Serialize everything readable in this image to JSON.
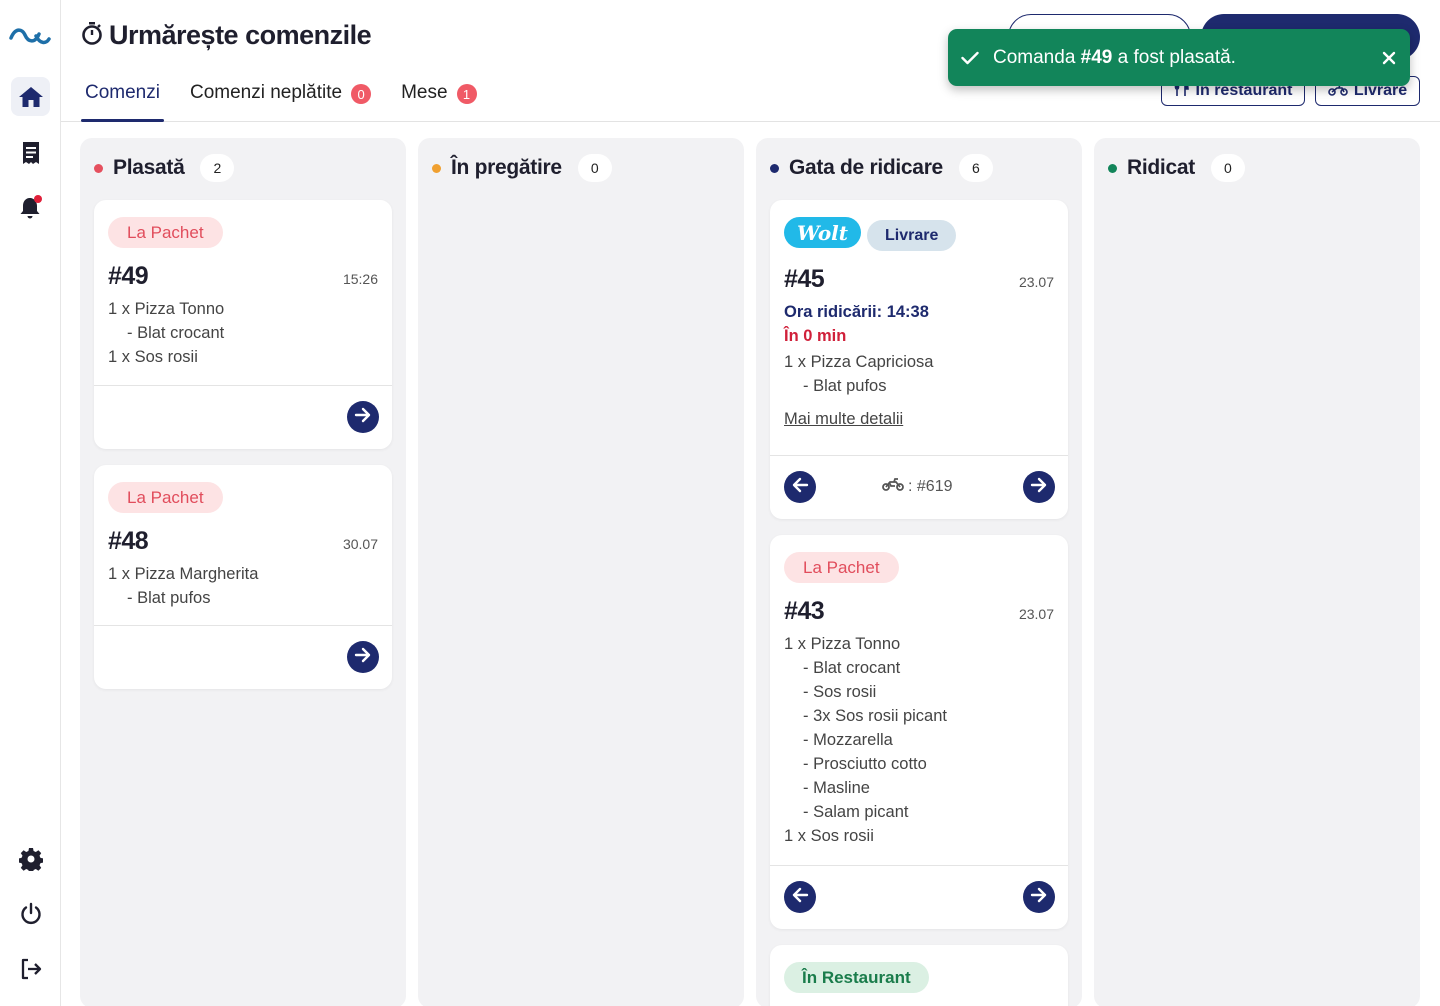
{
  "app": {
    "title": "Urmărește comenzile"
  },
  "tabs": [
    {
      "label": "Comenzi",
      "active": true
    },
    {
      "label": "Comenzi neplătite",
      "badge": "0"
    },
    {
      "label": "Mese",
      "badge": "1"
    }
  ],
  "filters": {
    "restaurant_label": "În restaurant",
    "delivery_label": "Livrare"
  },
  "toast": {
    "prefix": "Comanda ",
    "order": "#49",
    "suffix": " a fost plasată."
  },
  "columns": [
    {
      "title": "Plasată",
      "count": "2",
      "dot_color": "#e5505e"
    },
    {
      "title": "În pregătire",
      "count": "0",
      "dot_color": "#f0a030"
    },
    {
      "title": "Gata de ridicare",
      "count": "6",
      "dot_color": "#1e2a6e"
    },
    {
      "title": "Ridicat",
      "count": "0",
      "dot_color": "#12855a"
    }
  ],
  "cards": {
    "c49": {
      "tag": "La Pachet",
      "number": "#49",
      "time": "15:26",
      "lines": [
        "1 x Pizza Tonno",
        "- Blat crocant",
        "1 x Sos rosii"
      ]
    },
    "c48": {
      "tag": "La Pachet",
      "number": "#48",
      "time": "30.07",
      "lines": [
        "1 x Pizza Margherita",
        "- Blat pufos"
      ]
    },
    "c45": {
      "tag_brand": "Wolt",
      "tag": "Livrare",
      "number": "#45",
      "time": "23.07",
      "pickup": "Ora ridicării: 14:38",
      "eta": "În 0 min",
      "lines": [
        "1 x Pizza Capriciosa",
        "- Blat pufos"
      ],
      "more": "Mai multe detalii",
      "courier": ": #619"
    },
    "c43": {
      "tag": "La Pachet",
      "number": "#43",
      "time": "23.07",
      "lines": [
        "1 x Pizza Tonno",
        "- Blat crocant",
        "- Sos rosii",
        "- 3x Sos rosii picant",
        "- Mozzarella",
        "- Prosciutto cotto",
        "- Masline",
        "- Salam picant",
        "1 x Sos rosii"
      ]
    },
    "c_next": {
      "tag": "În Restaurant"
    }
  },
  "colors": {
    "primary": "#1e2a6e",
    "toast": "#12855a",
    "badge": "#f05a66"
  }
}
